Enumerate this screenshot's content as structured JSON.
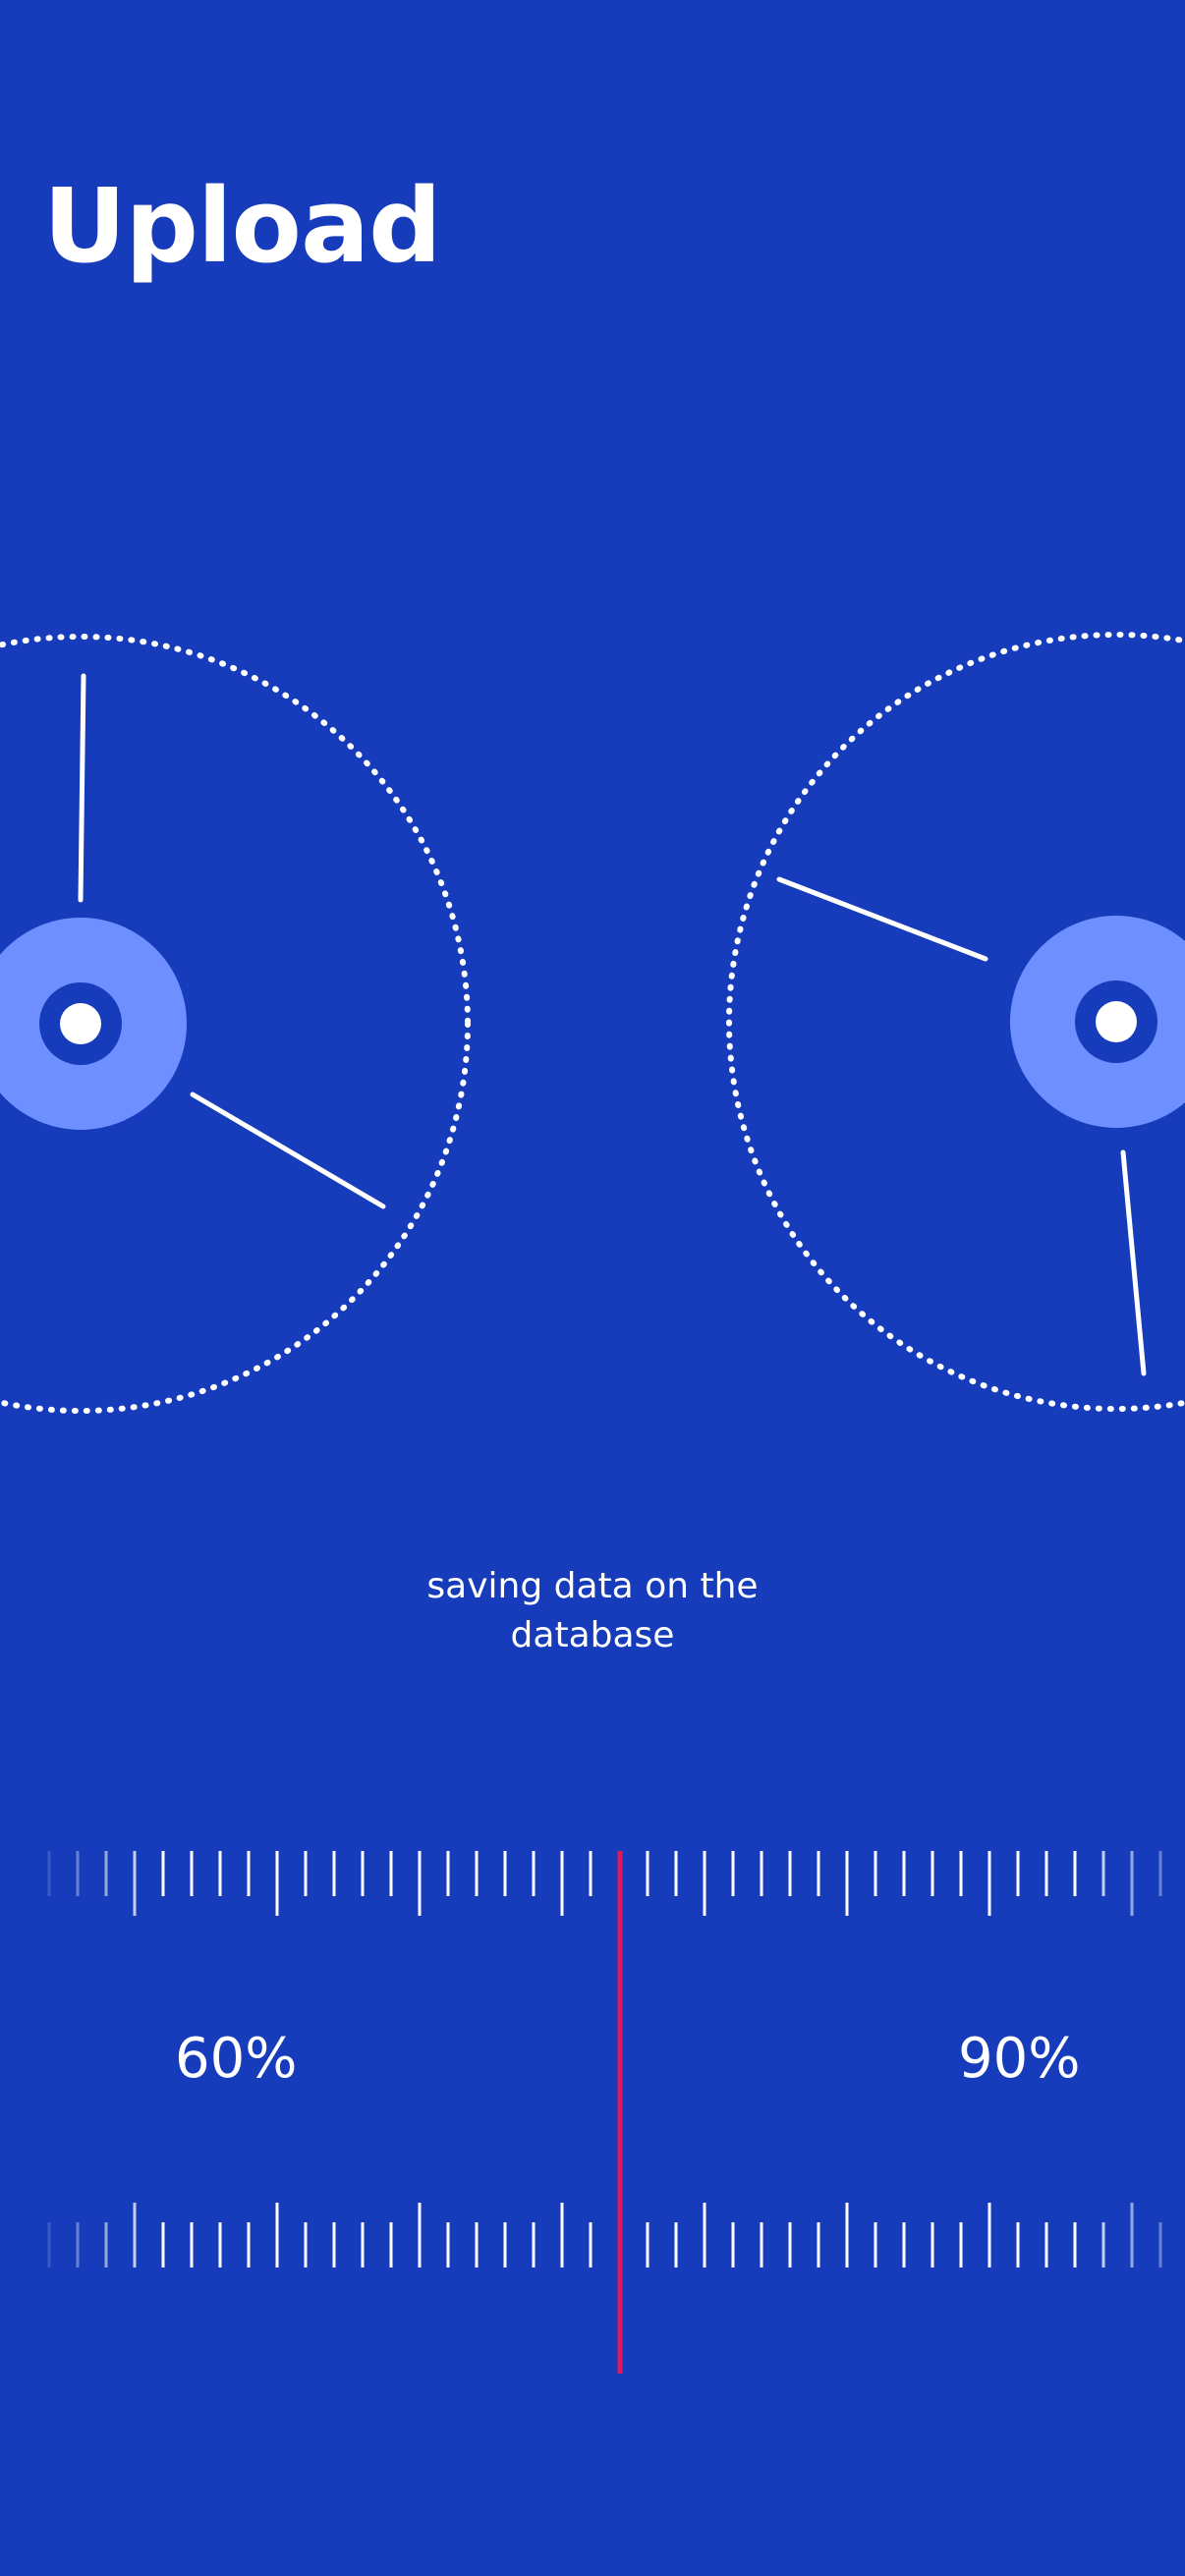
{
  "header": {
    "title": "Upload"
  },
  "status": {
    "line1": "saving data on the",
    "line2": "database"
  },
  "meter": {
    "left_label": "60%",
    "right_label": "90%",
    "needle_color": "#E0185A"
  },
  "colors": {
    "background": "#163CBB",
    "hub": "#6E8FFF",
    "hub_inner": "#163CBB",
    "tick": "#FFFFFF"
  },
  "icons": {
    "left_reel": "tape-reel-icon",
    "right_reel": "tape-reel-icon"
  }
}
